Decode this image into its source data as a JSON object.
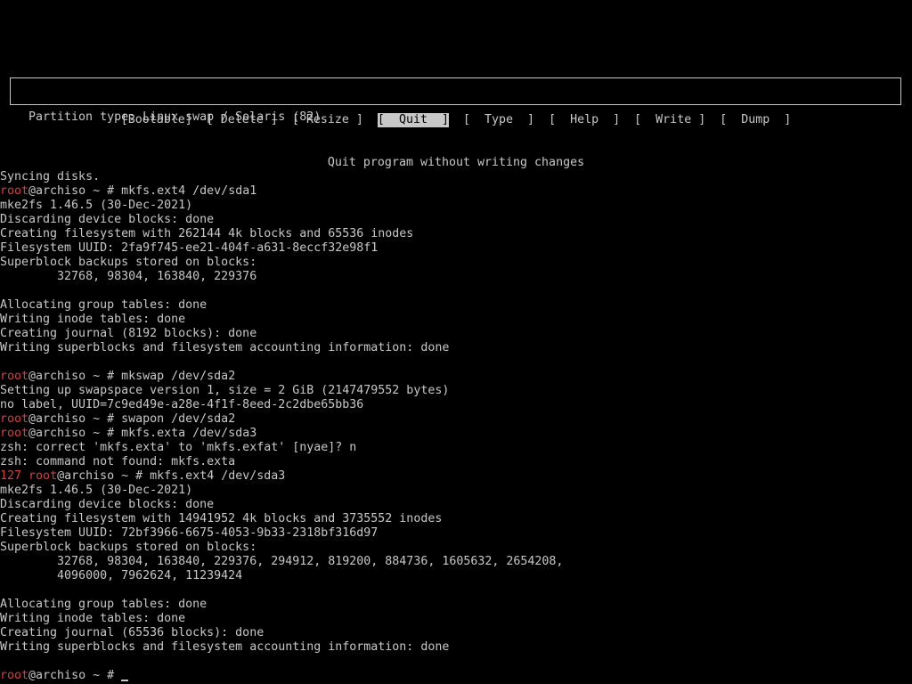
{
  "info_box": {
    "text": "Partition type: Linux swap / Solaris (82)"
  },
  "menu": {
    "items": [
      {
        "label": "[Bootable]",
        "selected": false
      },
      {
        "label": "[ Delete ]",
        "selected": false
      },
      {
        "label": "[ Resize ]",
        "selected": false
      },
      {
        "label": "[  Quit  ]",
        "selected": true
      },
      {
        "label": "[  Type  ]",
        "selected": false
      },
      {
        "label": "[  Help  ]",
        "selected": false
      },
      {
        "label": "[  Write ]",
        "selected": false
      },
      {
        "label": "[  Dump  ]",
        "selected": false
      }
    ]
  },
  "hint": "Quit program without writing changes",
  "prompt": {
    "user": "root",
    "host_and_dir": "@archiso ~ # "
  },
  "colors": {
    "foreground": "#c8c8c8",
    "background": "#000000",
    "prompt_user": "#e0393e"
  },
  "terminal_lines": [
    {
      "type": "text",
      "text": "Syncing disks."
    },
    {
      "type": "prompt",
      "cmd": "mkfs.ext4 /dev/sda1"
    },
    {
      "type": "text",
      "text": "mke2fs 1.46.5 (30-Dec-2021)"
    },
    {
      "type": "text",
      "text": "Discarding device blocks: done"
    },
    {
      "type": "text",
      "text": "Creating filesystem with 262144 4k blocks and 65536 inodes"
    },
    {
      "type": "text",
      "text": "Filesystem UUID: 2fa9f745-ee21-404f-a631-8eccf32e98f1"
    },
    {
      "type": "text",
      "text": "Superblock backups stored on blocks:"
    },
    {
      "type": "text",
      "text": "        32768, 98304, 163840, 229376"
    },
    {
      "type": "text",
      "text": ""
    },
    {
      "type": "text",
      "text": "Allocating group tables: done"
    },
    {
      "type": "text",
      "text": "Writing inode tables: done"
    },
    {
      "type": "text",
      "text": "Creating journal (8192 blocks): done"
    },
    {
      "type": "text",
      "text": "Writing superblocks and filesystem accounting information: done"
    },
    {
      "type": "text",
      "text": ""
    },
    {
      "type": "prompt",
      "cmd": "mkswap /dev/sda2"
    },
    {
      "type": "text",
      "text": "Setting up swapspace version 1, size = 2 GiB (2147479552 bytes)"
    },
    {
      "type": "text",
      "text": "no label, UUID=7c9ed49e-a28e-4f1f-8eed-2c2dbe65bb36"
    },
    {
      "type": "prompt",
      "cmd": "swapon /dev/sda2"
    },
    {
      "type": "prompt",
      "cmd": "mkfs.exta /dev/sda3"
    },
    {
      "type": "text",
      "text": "zsh: correct 'mkfs.exta' to 'mkfs.exfat' [nyae]? n"
    },
    {
      "type": "text",
      "text": "zsh: command not found: mkfs.exta"
    },
    {
      "type": "prompt",
      "exit": "127",
      "cmd": "mkfs.ext4 /dev/sda3"
    },
    {
      "type": "text",
      "text": "mke2fs 1.46.5 (30-Dec-2021)"
    },
    {
      "type": "text",
      "text": "Discarding device blocks: done"
    },
    {
      "type": "text",
      "text": "Creating filesystem with 14941952 4k blocks and 3735552 inodes"
    },
    {
      "type": "text",
      "text": "Filesystem UUID: 72bf3966-6675-4053-9b33-2318bf316d97"
    },
    {
      "type": "text",
      "text": "Superblock backups stored on blocks:"
    },
    {
      "type": "text",
      "text": "        32768, 98304, 163840, 229376, 294912, 819200, 884736, 1605632, 2654208,"
    },
    {
      "type": "text",
      "text": "        4096000, 7962624, 11239424"
    },
    {
      "type": "text",
      "text": ""
    },
    {
      "type": "text",
      "text": "Allocating group tables: done"
    },
    {
      "type": "text",
      "text": "Writing inode tables: done"
    },
    {
      "type": "text",
      "text": "Creating journal (65536 blocks): done"
    },
    {
      "type": "text",
      "text": "Writing superblocks and filesystem accounting information: done"
    },
    {
      "type": "text",
      "text": ""
    },
    {
      "type": "prompt",
      "cmd": "",
      "cursor": true
    }
  ]
}
